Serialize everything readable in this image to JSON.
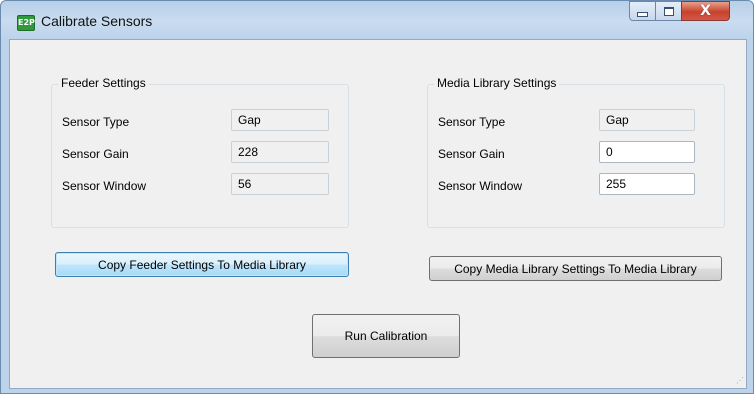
{
  "window": {
    "icon_text": "E2P",
    "title": "Calibrate Sensors",
    "minimize_icon": "minimize-icon",
    "maximize_icon": "maximize-icon",
    "close_icon": "close-icon",
    "close_glyph": "X"
  },
  "feeder": {
    "title": "Feeder Settings",
    "rows": [
      {
        "label": "Sensor Type",
        "value": "Gap"
      },
      {
        "label": "Sensor Gain",
        "value": "228"
      },
      {
        "label": "Sensor Window",
        "value": "56"
      }
    ]
  },
  "media": {
    "title": "Media Library Settings",
    "rows": [
      {
        "label": "Sensor Type",
        "value": "Gap"
      },
      {
        "label": "Sensor Gain",
        "value": "0"
      },
      {
        "label": "Sensor Window",
        "value": "255"
      }
    ]
  },
  "buttons": {
    "copy_feeder": "Copy Feeder Settings To Media Library",
    "copy_media": "Copy Media Library Settings To Media Library",
    "run": "Run Calibration"
  }
}
